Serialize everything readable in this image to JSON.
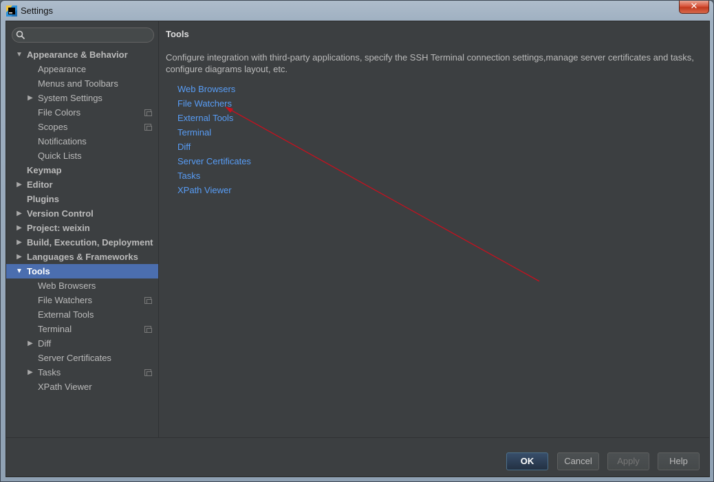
{
  "window": {
    "title": "Settings",
    "close_label": "✕"
  },
  "search": {
    "placeholder": ""
  },
  "sidebar": {
    "items": [
      {
        "label": "Appearance & Behavior",
        "level": 0,
        "bold": true,
        "expanded": true
      },
      {
        "label": "Appearance",
        "level": 1
      },
      {
        "label": "Menus and Toolbars",
        "level": 1
      },
      {
        "label": "System Settings",
        "level": 1,
        "collapsed": true
      },
      {
        "label": "File Colors",
        "level": 1,
        "project": true
      },
      {
        "label": "Scopes",
        "level": 1,
        "project": true
      },
      {
        "label": "Notifications",
        "level": 1
      },
      {
        "label": "Quick Lists",
        "level": 1
      },
      {
        "label": "Keymap",
        "level": 0,
        "bold": true
      },
      {
        "label": "Editor",
        "level": 0,
        "bold": true,
        "collapsed": true
      },
      {
        "label": "Plugins",
        "level": 0,
        "bold": true
      },
      {
        "label": "Version Control",
        "level": 0,
        "bold": true,
        "collapsed": true
      },
      {
        "label": "Project: weixin",
        "level": 0,
        "bold": true,
        "collapsed": true
      },
      {
        "label": "Build, Execution, Deployment",
        "level": 0,
        "bold": true,
        "collapsed": true
      },
      {
        "label": "Languages & Frameworks",
        "level": 0,
        "bold": true,
        "collapsed": true
      },
      {
        "label": "Tools",
        "level": 0,
        "bold": true,
        "expanded": true,
        "selected": true
      },
      {
        "label": "Web Browsers",
        "level": 1
      },
      {
        "label": "File Watchers",
        "level": 1,
        "project": true
      },
      {
        "label": "External Tools",
        "level": 1
      },
      {
        "label": "Terminal",
        "level": 1,
        "project": true
      },
      {
        "label": "Diff",
        "level": 1,
        "collapsed": true
      },
      {
        "label": "Server Certificates",
        "level": 1
      },
      {
        "label": "Tasks",
        "level": 1,
        "collapsed": true,
        "project": true
      },
      {
        "label": "XPath Viewer",
        "level": 1
      }
    ]
  },
  "main": {
    "title": "Tools",
    "description": "Configure integration with third-party applications, specify the SSH Terminal connection settings,manage server certificates and tasks, configure diagrams layout, etc.",
    "links": [
      "Web Browsers",
      "File Watchers",
      "External Tools",
      "Terminal",
      "Diff",
      "Server Certificates",
      "Tasks",
      "XPath Viewer"
    ]
  },
  "footer": {
    "ok_label": "OK",
    "cancel_label": "Cancel",
    "apply_label": "Apply",
    "help_label": "Help"
  },
  "colors": {
    "background": "#3c3f41",
    "selection": "#4b6eaf",
    "link": "#589df6",
    "annotation_arrow": "#c8101e"
  }
}
